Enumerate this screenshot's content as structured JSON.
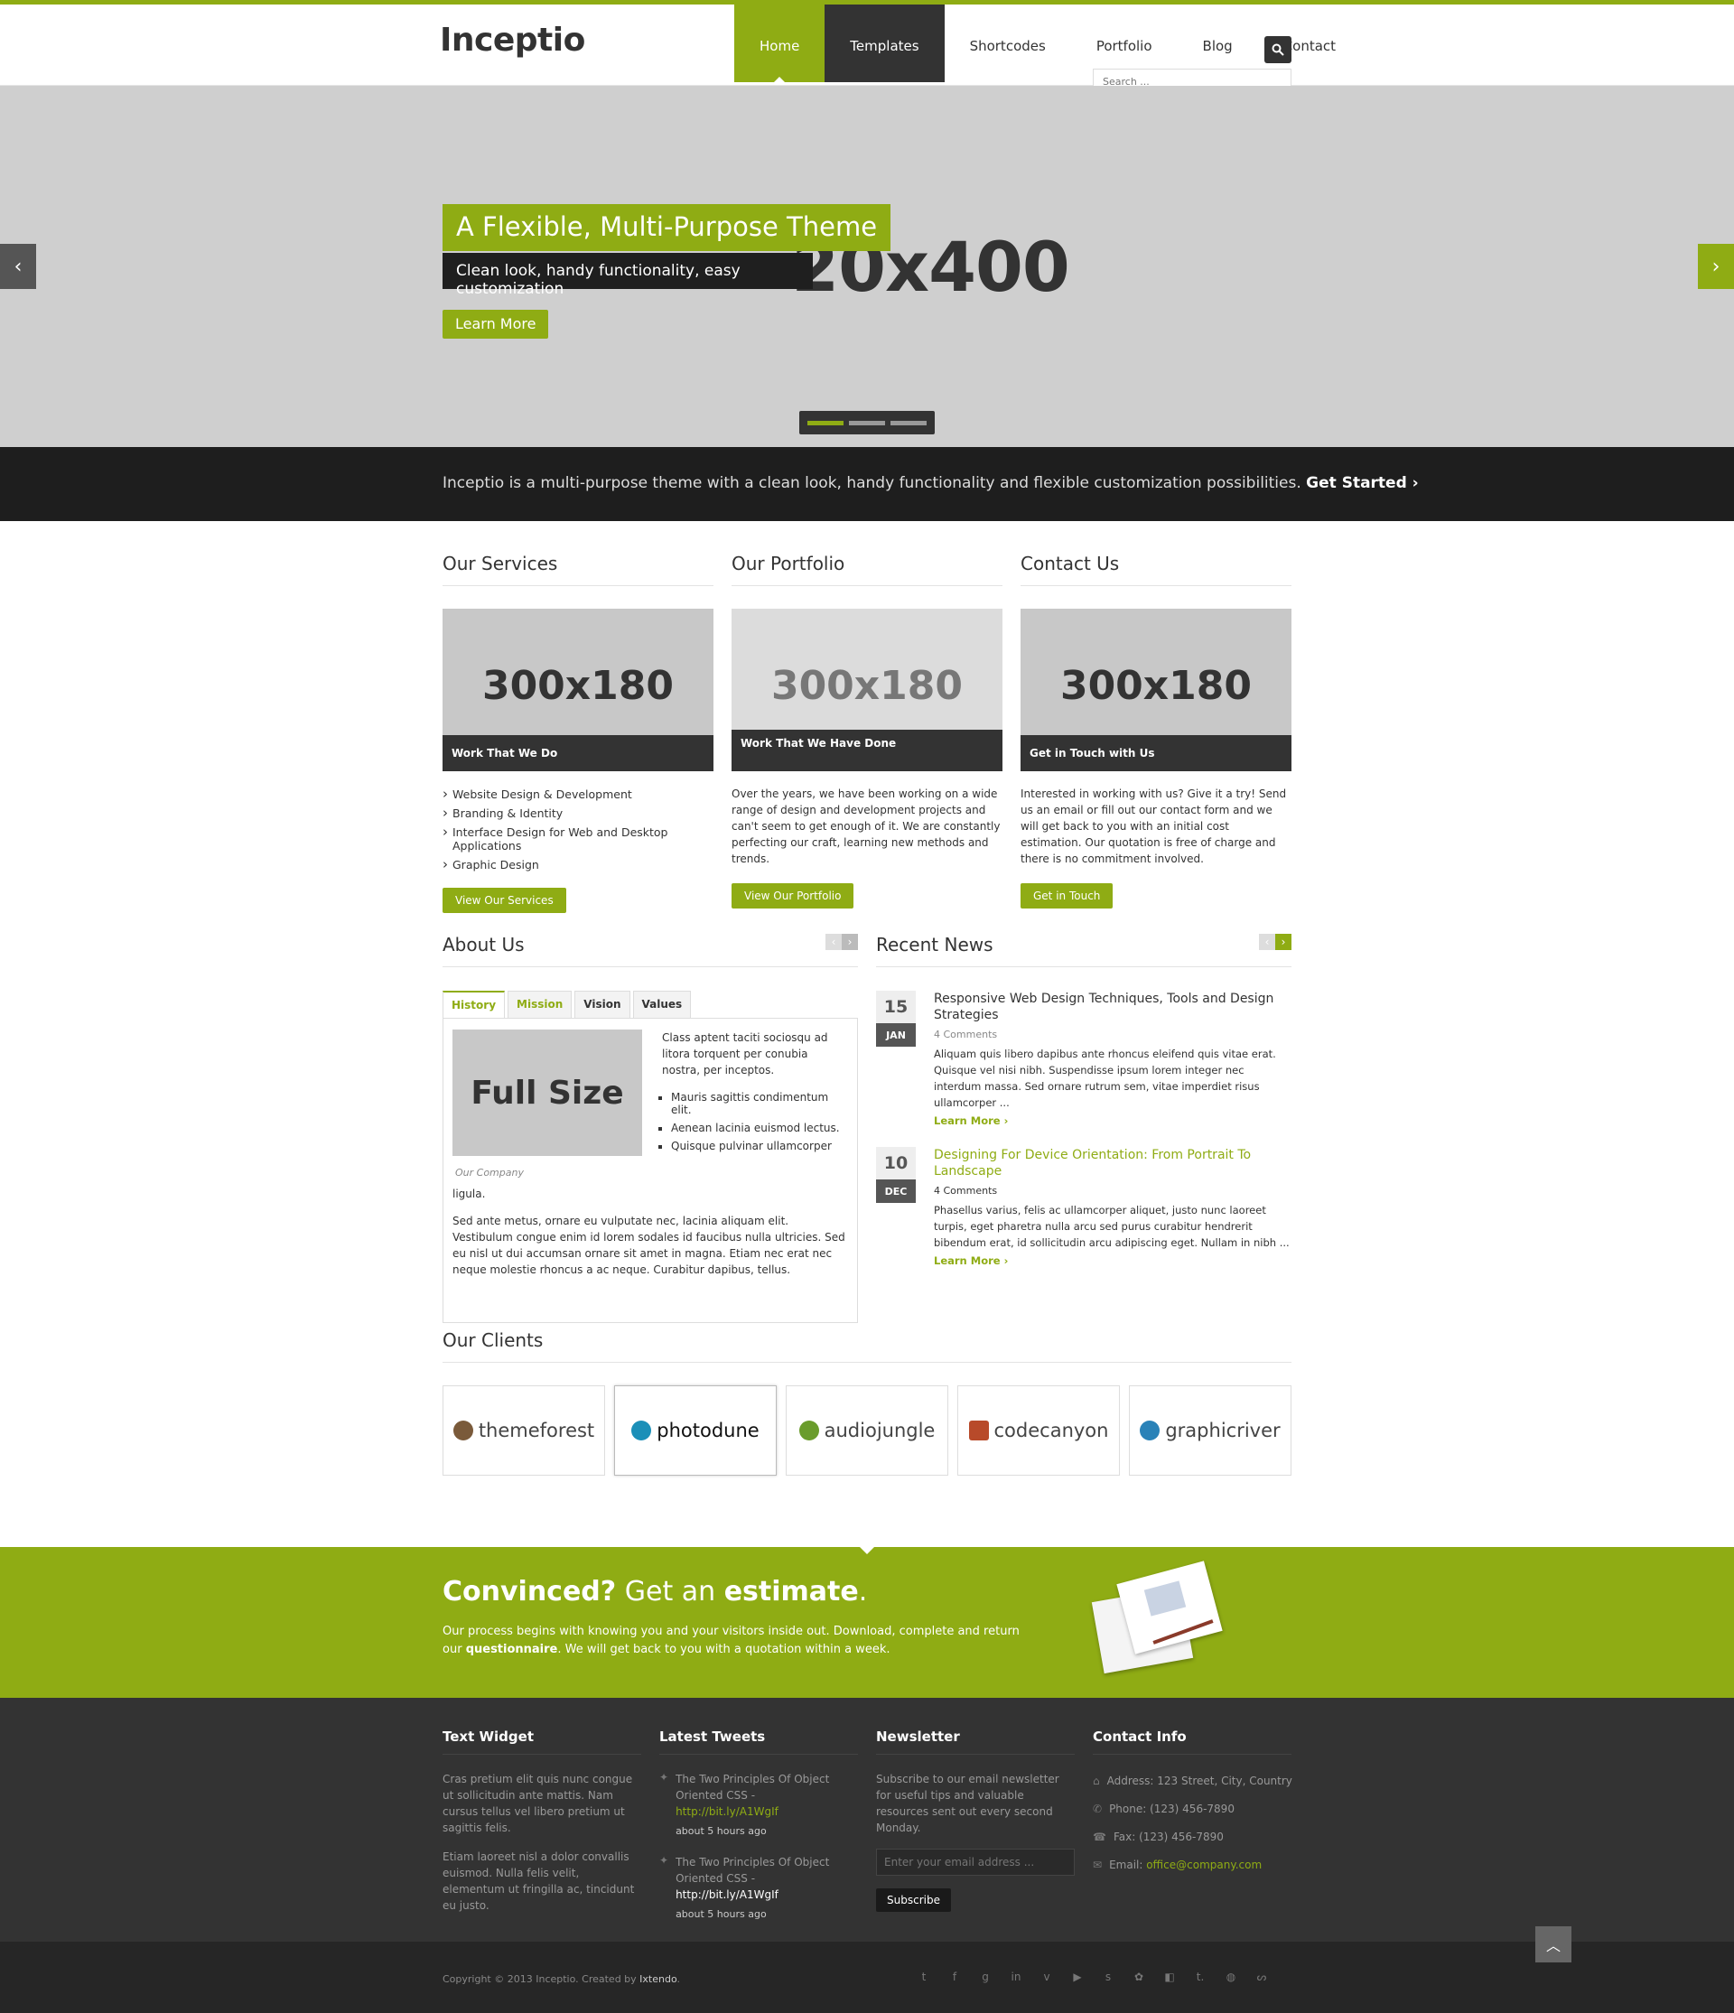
{
  "header": {
    "logo": "Inceptio",
    "nav": [
      "Home",
      "Templates",
      "Shortcodes",
      "Portfolio",
      "Blog",
      "Contact"
    ],
    "search_placeholder": "Search ..."
  },
  "slider": {
    "placeholder": "20x400",
    "title": "A Flexible, Multi-Purpose Theme",
    "subtitle": "Clean look, handy functionality, easy customization",
    "button": "Learn More",
    "slide_count": 3,
    "active_slide": 1
  },
  "band": {
    "text": "Inceptio is a multi-purpose theme with a clean look, handy functionality and flexible customization possibilities.",
    "link": "Get Started ›"
  },
  "services": {
    "heading": "Our Services",
    "image": "300x180",
    "caption": "Work That We Do",
    "items": [
      "Website Design & Development",
      "Branding & Identity",
      "Interface Design for Web and Desktop Applications",
      "Graphic Design"
    ],
    "button": "View Our Services"
  },
  "portfolio": {
    "heading": "Our Portfolio",
    "image": "300x180",
    "caption": "Work That We Have Done",
    "text": "Over the years, we have been working on a wide range of design and development projects and can't seem to get enough of it. We are constantly perfecting our craft, learning new methods and trends.",
    "button": "View Our Portfolio"
  },
  "contact": {
    "heading": "Contact Us",
    "image": "300x180",
    "caption": "Get in Touch with Us",
    "text": "Interested in working with us? Give it a try! Send us an email or fill out our contact form and we will get back to you with an initial cost estimation. Our quotation is free of charge and there is no commitment involved.",
    "button": "Get in Touch"
  },
  "about": {
    "heading": "About Us",
    "tabs": [
      "History",
      "Mission",
      "Vision",
      "Values"
    ],
    "image": "Full Size",
    "image_caption": "Our Company",
    "intro": "Class aptent taciti sociosqu ad litora torquent per conubia nostra, per inceptos.",
    "bullets": [
      "Mauris sagittis condimentum elit.",
      "Aenean lacinia euismod lectus.",
      "Quisque pulvinar ullamcorper"
    ],
    "ligula": "ligula.",
    "body": "Sed ante metus, ornare eu vulputate nec, lacinia aliquam elit. Vestibulum congue enim id lorem sodales id faucibus nulla ultricies. Sed eu nisl ut dui accumsan ornare sit amet in magna. Etiam nec erat nec neque molestie rhoncus a ac neque. Curabitur dapibus, tellus."
  },
  "news": {
    "heading": "Recent News",
    "items": [
      {
        "day": "15",
        "month": "JAN",
        "title": "Responsive Web Design Techniques, Tools and Design Strategies",
        "comments": "4 Comments",
        "text": "Aliquam quis libero dapibus ante rhoncus eleifend quis vitae erat. Quisque vel nisi nibh. Suspendisse ipsum lorem integer nec interdum massa. Sed ornare rutrum sem, vitae imperdiet risus ullamcorper ...",
        "more": "Learn More ›"
      },
      {
        "day": "10",
        "month": "DEC",
        "title": "Designing For Device Orientation: From Portrait To Landscape",
        "comments": "4 Comments",
        "text": "Phasellus varius, felis ac ullamcorper aliquet, justo nunc laoreet turpis, eget pharetra nulla arcu sed purus curabitur hendrerit bibendum erat, id sollicitudin arcu adipiscing eget. Nullam in nibh ...",
        "more": "Learn More ›"
      }
    ]
  },
  "clients": {
    "heading": "Our Clients",
    "items": [
      "themeforest",
      "photodune",
      "audiojungle",
      "codecanyon",
      "graphicriver"
    ]
  },
  "cta": {
    "title_a": "Convinced?",
    "title_b": "Get an",
    "title_c": "estimate",
    "title_d": ".",
    "text_a": "Our process begins with knowing you and your visitors inside out. Download, complete and return our",
    "text_b": "questionnaire",
    "text_c": ". We will get back to you with a quotation within a week."
  },
  "footer": {
    "text_widget": {
      "heading": "Text Widget",
      "p1": "Cras pretium elit quis nunc congue ut sollicitudin ante mattis. Nam cursus tellus vel libero pretium ut sagittis felis.",
      "p2": "Etiam laoreet nisl a dolor convallis euismod. Nulla felis velit, elementum ut fringilla ac, tincidunt eu justo."
    },
    "tweets": {
      "heading": "Latest Tweets",
      "items": [
        {
          "text": "The Two Principles Of Object Oriented CSS - ",
          "link": "http://bit.ly/A1WgIf",
          "time": "about 5 hours ago"
        },
        {
          "text": "The Two Principles Of Object Oriented CSS - ",
          "link": "http://bit.ly/A1WgIf",
          "time": "about 5 hours ago"
        }
      ]
    },
    "newsletter": {
      "heading": "Newsletter",
      "text": "Subscribe to our email newsletter for useful tips and valuable resources sent out every second Monday.",
      "placeholder": "Enter your email address ...",
      "button": "Subscribe"
    },
    "contact": {
      "heading": "Contact Info",
      "address": "Address: 123 Street, City, Country",
      "phone": "Phone: (123) 456-7890",
      "fax": "Fax: (123) 456-7890",
      "email_label": "Email: ",
      "email": "office@company.com"
    }
  },
  "bottom": {
    "copyright": "Copyright © 2013 Inceptio. Created by ",
    "author": "Ixtendo",
    "social": [
      "twitter-icon",
      "facebook-icon",
      "google-plus-icon",
      "linkedin-icon",
      "vimeo-icon",
      "youtube-icon",
      "skype-icon",
      "myspace-icon",
      "delicious-icon",
      "tumblr-icon",
      "dribbble-icon",
      "stumbleupon-icon"
    ]
  },
  "colors": {
    "accent": "#8fac14",
    "dark": "#333333",
    "band": "#1e1e1e"
  }
}
